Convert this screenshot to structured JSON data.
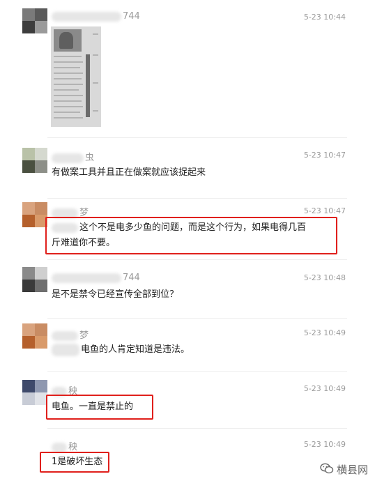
{
  "comments": [
    {
      "name_suffix": "744",
      "time": "5-23 10:44",
      "text": ""
    },
    {
      "name_suffix": "虫",
      "time": "5-23 10:47",
      "text": "有做案工具并且正在做案就应该捉起来"
    },
    {
      "name_suffix": "梦",
      "time": "5-23 10:47",
      "text_line1": "这个不是电多少鱼的问题，而是这个行为，如果电得几百",
      "text_line2": "斤难道你不要。"
    },
    {
      "name_suffix": "744",
      "time": "5-23 10:48",
      "text": "是不是禁令已经宣传全部到位？"
    },
    {
      "name_suffix": "梦",
      "time": "5-23 10:49",
      "text": "电鱼的人肯定知道是违法。"
    },
    {
      "name_suffix": "秧",
      "time": "5-23 10:49",
      "text": "电鱼。一直是禁止的"
    },
    {
      "name_suffix": "秧",
      "time": "5-23 10:49",
      "text": "1是破坏生态"
    }
  ],
  "watermark": {
    "label": "横县网",
    "icon": "wechat-icon"
  },
  "colors": {
    "highlight": "#e0201c",
    "meta": "#9a9a9a",
    "text": "#222222"
  }
}
